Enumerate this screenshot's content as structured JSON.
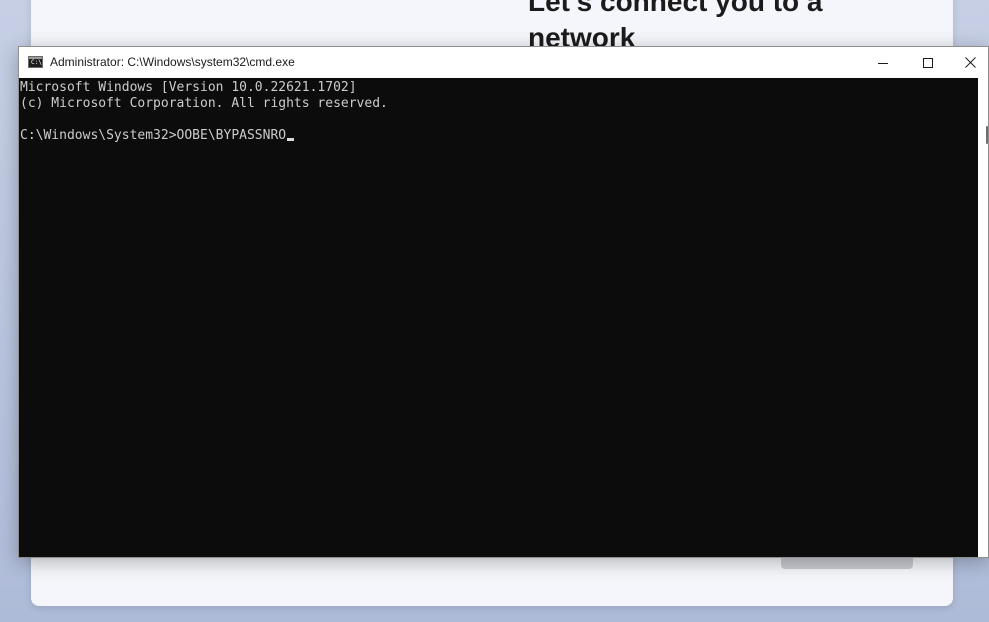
{
  "oobe": {
    "title": "Let's connect you to a network"
  },
  "window": {
    "title": "Administrator: C:\\Windows\\system32\\cmd.exe",
    "icon": "cmd-icon",
    "icon_glyph": "C:\\",
    "buttons": [
      "minimize-icon",
      "maximize-icon",
      "close-icon"
    ]
  },
  "console": {
    "lines": [
      "Microsoft Windows [Version 10.0.22621.1702]",
      "(c) Microsoft Corporation. All rights reserved.",
      "",
      "C:\\Windows\\System32>OOBE\\BYPASSNRO"
    ],
    "background": "#0c0c0c",
    "foreground": "#cccccc"
  }
}
